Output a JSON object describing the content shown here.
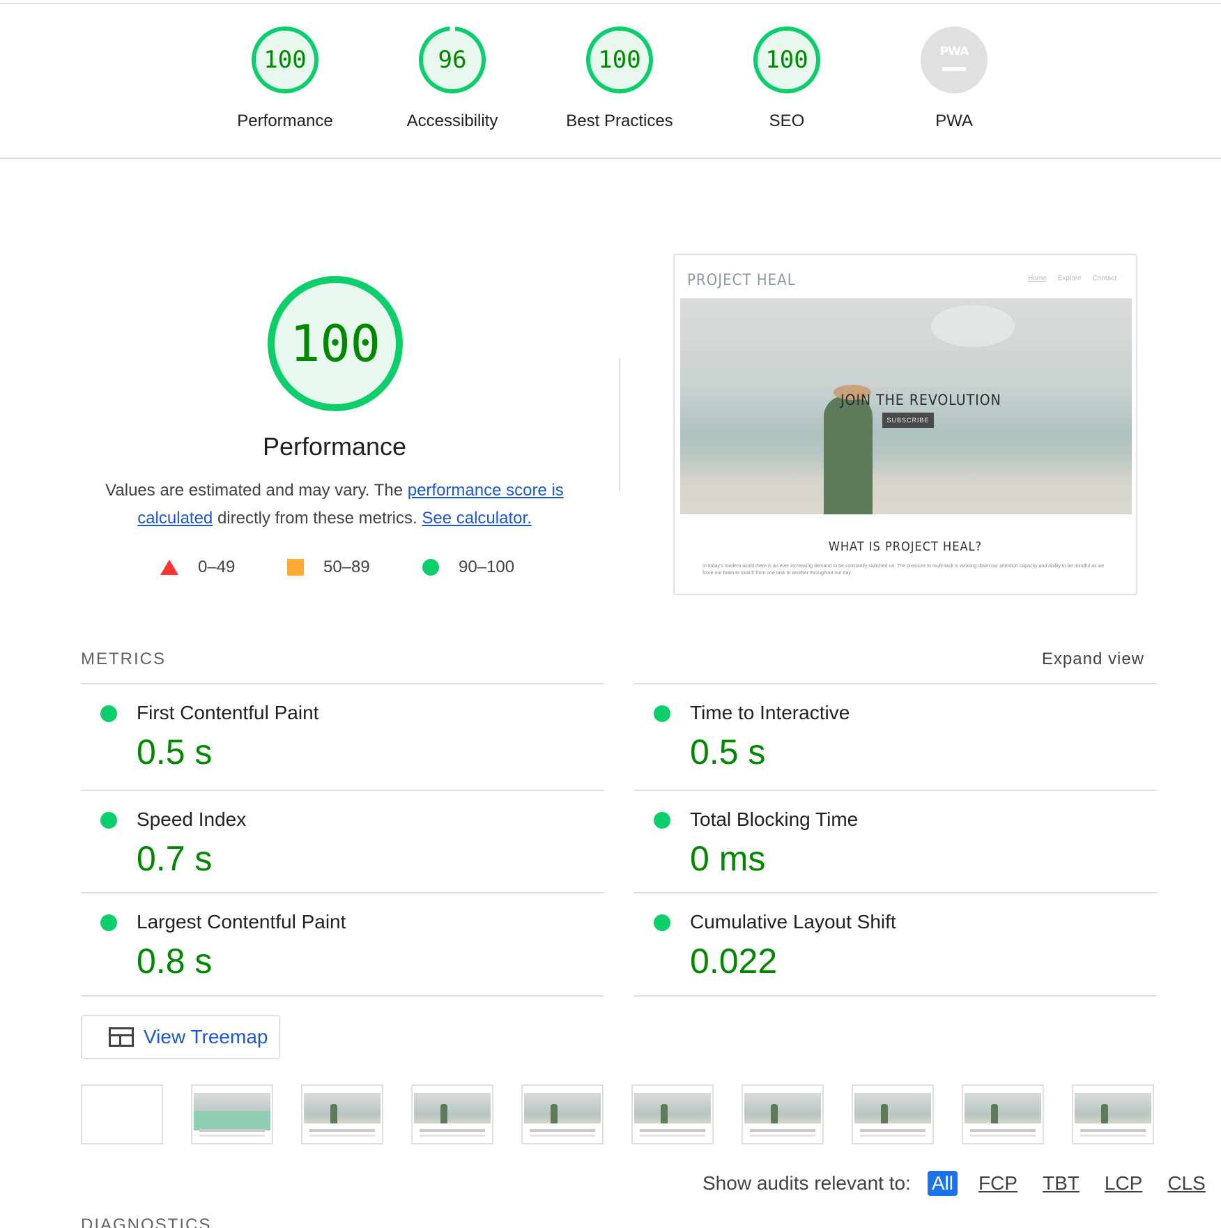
{
  "scores": [
    {
      "label": "Performance",
      "value": "100"
    },
    {
      "label": "Accessibility",
      "value": "96"
    },
    {
      "label": "Best Practices",
      "value": "100"
    },
    {
      "label": "SEO",
      "value": "100"
    },
    {
      "label": "PWA",
      "value": "PWA"
    }
  ],
  "main": {
    "score": "100",
    "title": "Performance",
    "desc_prefix": "Values are estimated and may vary. The ",
    "desc_link1": "performance score is calculated",
    "desc_middle": " directly from these metrics. ",
    "desc_link2": "See calculator."
  },
  "legend": {
    "fail": "0–49",
    "average": "50–89",
    "pass": "90–100"
  },
  "screenshot": {
    "brand": "PROJECT HEAL",
    "nav": [
      "Home",
      "Explore",
      "Contact"
    ],
    "hero_title": "JOIN THE REVOLUTION",
    "hero_button": "SUBSCRIBE",
    "heading": "WHAT IS PROJECT HEAL?",
    "paragraph": "In today's modern world there is an ever increasing demand to be constantly switched on. The pressure to multi-task is wearing down our attention capacity and ability to be mindful as we force our brain to switch from one task to another throughout our day."
  },
  "metrics": {
    "header": "METRICS",
    "expand": "Expand view",
    "items": [
      {
        "title": "First Contentful Paint",
        "value": "0.5 s"
      },
      {
        "title": "Time to Interactive",
        "value": "0.5 s"
      },
      {
        "title": "Speed Index",
        "value": "0.7 s"
      },
      {
        "title": "Total Blocking Time",
        "value": "0 ms"
      },
      {
        "title": "Largest Contentful Paint",
        "value": "0.8 s"
      },
      {
        "title": "Cumulative Layout Shift",
        "value": "0.022"
      }
    ]
  },
  "treemap_label": "View Treemap",
  "audits": {
    "label": "Show audits relevant to:",
    "filters": [
      "All",
      "FCP",
      "TBT",
      "LCP",
      "CLS"
    ],
    "active": "All"
  },
  "diagnostics_header": "DIAGNOSTICS",
  "colors": {
    "pass": "#0cce6b",
    "pass_text": "#008800",
    "average": "#ffaa33",
    "fail": "#ff3333",
    "link": "#1a56db"
  }
}
